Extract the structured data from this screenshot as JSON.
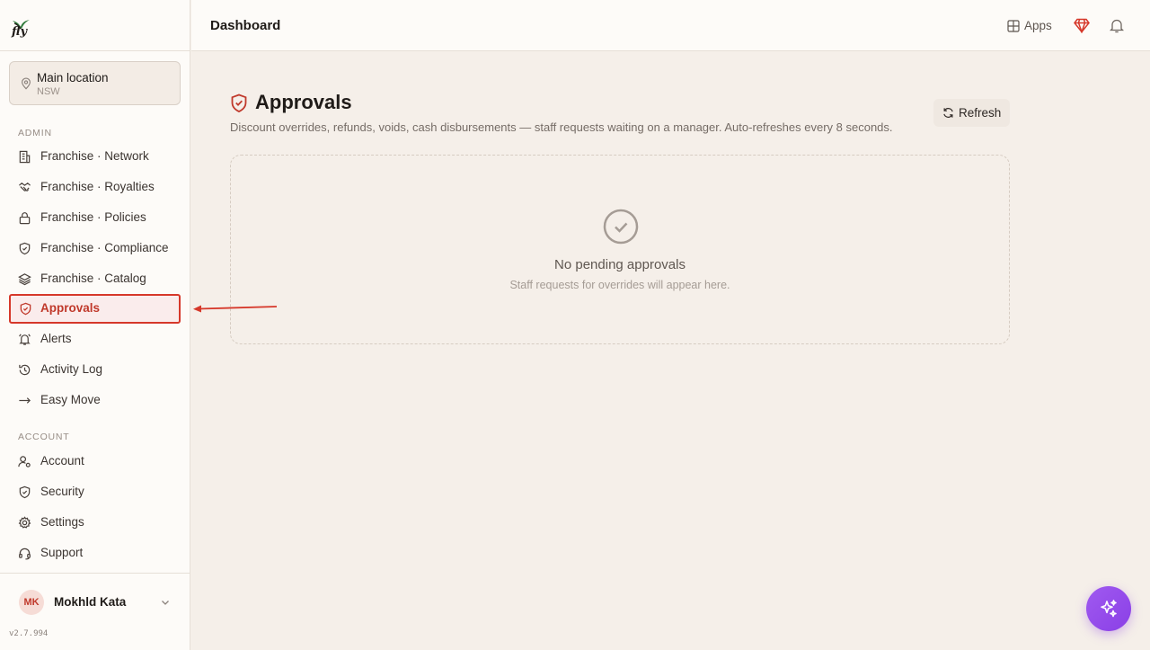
{
  "brand": {
    "logo_text": "fly"
  },
  "location": {
    "name": "Main location",
    "region": "NSW"
  },
  "sidebar": {
    "admin_label": "ADMIN",
    "admin_items": [
      {
        "label": "Franchise · Network",
        "icon": "building-icon"
      },
      {
        "label": "Franchise · Royalties",
        "icon": "handshake-icon"
      },
      {
        "label": "Franchise · Policies",
        "icon": "lock-icon"
      },
      {
        "label": "Franchise · Compliance",
        "icon": "shield-icon"
      },
      {
        "label": "Franchise · Catalog",
        "icon": "layers-icon"
      },
      {
        "label": "Approvals",
        "icon": "shield-check-icon",
        "active": true
      },
      {
        "label": "Alerts",
        "icon": "bell-icon"
      },
      {
        "label": "Activity Log",
        "icon": "history-icon"
      },
      {
        "label": "Easy Move",
        "icon": "arrow-right-icon"
      }
    ],
    "account_label": "ACCOUNT",
    "account_items": [
      {
        "label": "Account",
        "icon": "user-cog-icon"
      },
      {
        "label": "Security",
        "icon": "shield-icon"
      },
      {
        "label": "Settings",
        "icon": "gear-icon"
      },
      {
        "label": "Support",
        "icon": "headset-icon"
      }
    ]
  },
  "user": {
    "initials": "MK",
    "name": "Mokhld Kata"
  },
  "version": "v2.7.994",
  "header": {
    "title": "Dashboard",
    "apps_label": "Apps"
  },
  "main": {
    "title": "Approvals",
    "description": "Discount overrides, refunds, voids, cash disbursements — staff requests waiting on a manager. Auto-refreshes every 8 seconds.",
    "refresh_label": "Refresh",
    "empty_title": "No pending approvals",
    "empty_subtitle": "Staff requests for overrides will appear here."
  },
  "colors": {
    "accent": "#c0392b",
    "annotation": "#d6382a",
    "fab": "#9b51ee",
    "background": "#f5efe9"
  }
}
